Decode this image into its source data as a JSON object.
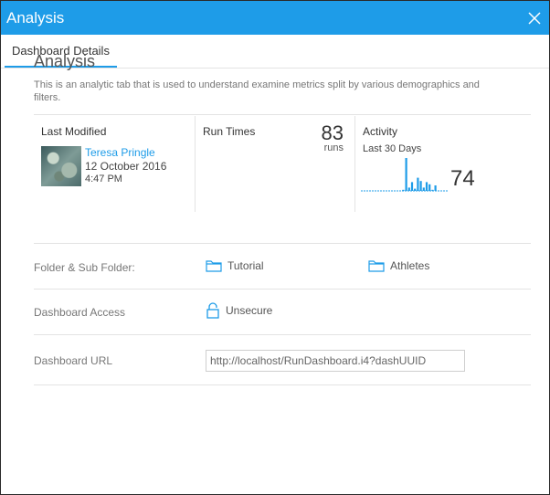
{
  "dialog": {
    "title": "Analysis",
    "close_icon": "close-icon",
    "accent_color": "#1e9ce8"
  },
  "tabs": [
    {
      "label": "Dashboard Details",
      "active": true
    }
  ],
  "details": {
    "title": "Analysis",
    "description": "This is an analytic tab that is used to understand examine metrics split by various demographics and filters."
  },
  "last_modified": {
    "label": "Last Modified",
    "user": "Teresa Pringle",
    "date": "12 October 2016",
    "time": "4:47 PM"
  },
  "run_times": {
    "label": "Run Times",
    "count": "83",
    "unit": "runs"
  },
  "activity": {
    "label": "Activity",
    "period": "Last 30 Days",
    "value": "74",
    "sparkline_color": "#1e9ce8",
    "daily_counts": [
      0,
      0,
      0,
      0,
      0,
      0,
      0,
      0,
      0,
      0,
      0,
      0,
      0,
      0,
      1,
      30,
      3,
      8,
      2,
      12,
      9,
      3,
      8,
      6,
      1,
      5,
      0,
      0,
      0,
      0
    ]
  },
  "folder": {
    "label": "Folder & Sub Folder:",
    "folder_name": "Tutorial",
    "sub_folder_name": "Athletes",
    "icon": "folder-icon"
  },
  "access": {
    "label": "Dashboard Access",
    "value": "Unsecure",
    "icon": "unlock-icon"
  },
  "url": {
    "label": "Dashboard URL",
    "value": "http://localhost/RunDashboard.i4?dashUUID"
  }
}
